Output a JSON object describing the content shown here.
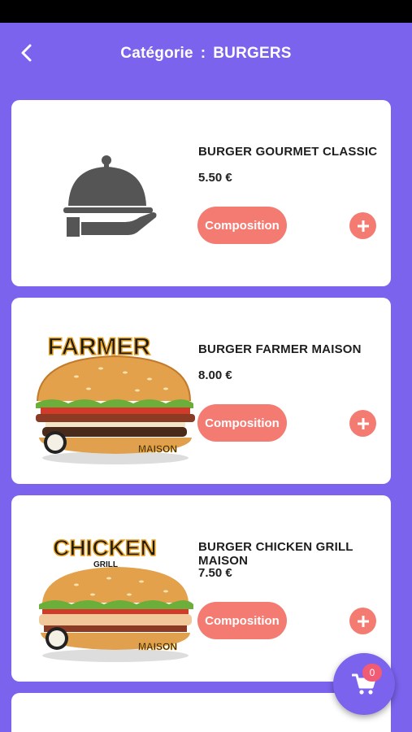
{
  "header": {
    "title_label": "Catégorie",
    "title_separator": ":",
    "category_name": "BURGERS"
  },
  "products": [
    {
      "name": "BURGER GOURMET CLASSIC",
      "price": "5.50 €",
      "composition_label": "Composition",
      "image": "cloche-serving-icon"
    },
    {
      "name": "BURGER FARMER MAISON",
      "price": "8.00 €",
      "composition_label": "Composition",
      "image": "farmer-burger-photo",
      "image_text": "FARMER",
      "image_badge": "MAISON"
    },
    {
      "name": "BURGER CHICKEN GRILL MAISON",
      "price": "7.50 €",
      "composition_label": "Composition",
      "image": "chicken-burger-photo",
      "image_text": "CHICKEN",
      "image_subtext": "GRILL",
      "image_badge": "MAISON"
    }
  ],
  "cart": {
    "count": "0"
  },
  "colors": {
    "primary": "#7b63ee",
    "accent": "#f47b72",
    "badge": "#f25b73",
    "card": "#ffffff"
  }
}
